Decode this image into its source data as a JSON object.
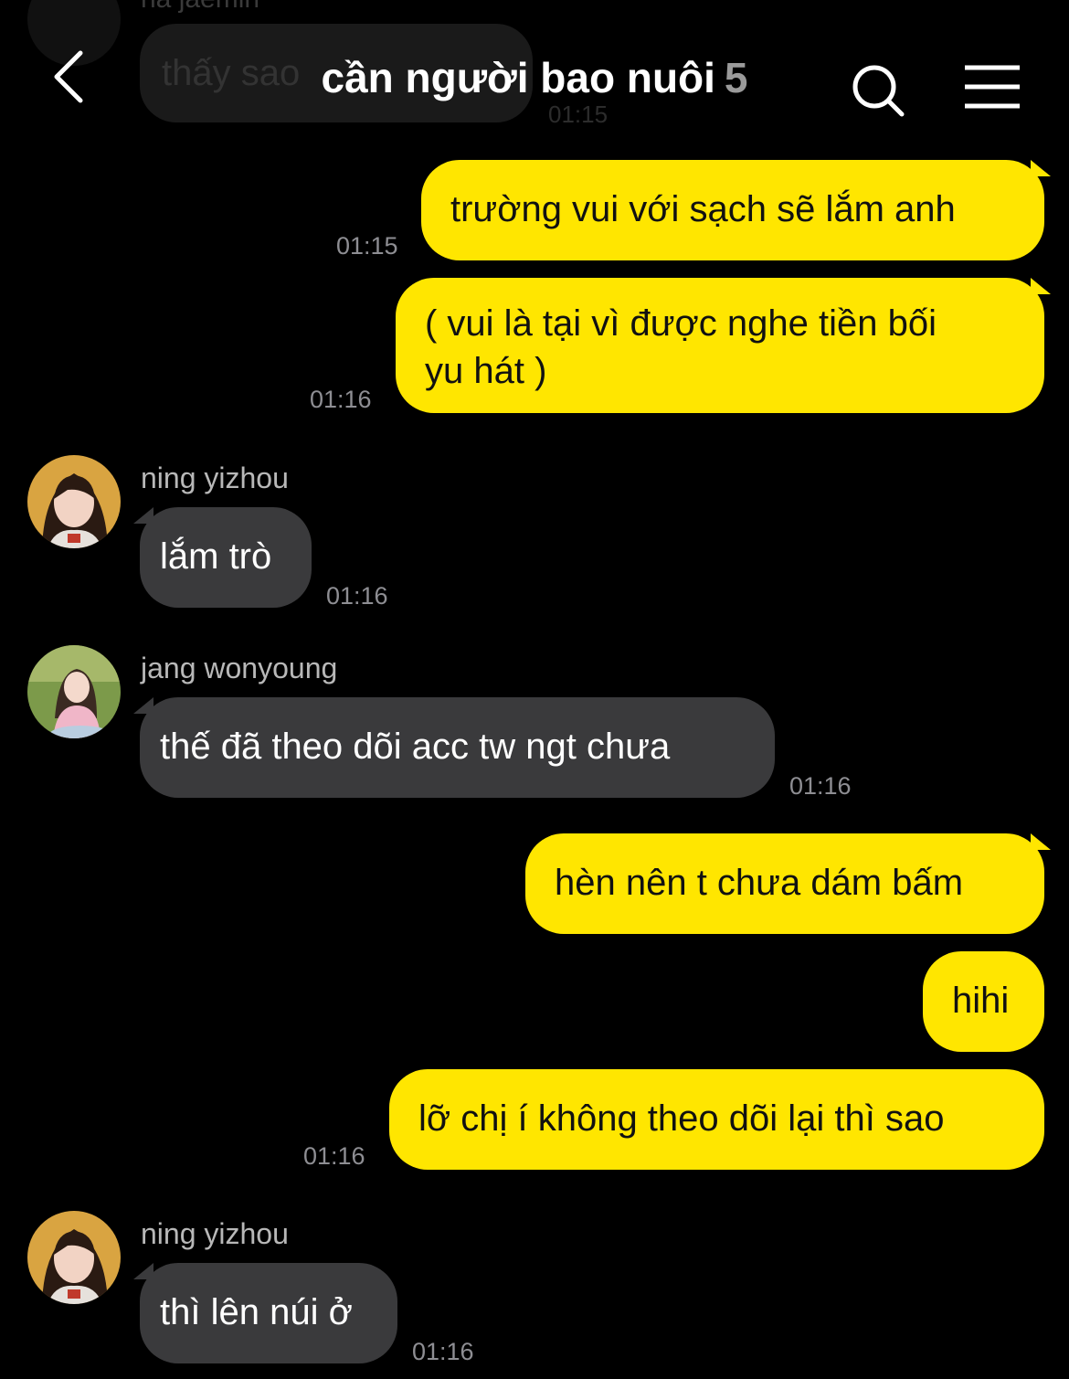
{
  "faded": {
    "sender": "na jaemin",
    "text": "thấy sao",
    "time": "01:15"
  },
  "header": {
    "title": "cần người bao nuôi",
    "member_count": "5",
    "icons": {
      "back": "chevron-left-icon",
      "search": "search-icon",
      "menu": "hamburger-menu-icon"
    }
  },
  "messages": [
    {
      "from": "me",
      "text": "trường vui với sạch sẽ lắm anh",
      "time": "01:15"
    },
    {
      "from": "me",
      "text": "( vui là tại vì được nghe tiền bối yu hát )",
      "line1": "( vui là tại vì được nghe tiền bối",
      "line2": "yu hát )",
      "time": "01:16"
    },
    {
      "from": "ning yizhou",
      "text": "lắm trò",
      "time": "01:16"
    },
    {
      "from": "jang wonyoung",
      "text": "thế đã theo dõi acc tw ngt chưa",
      "time": "01:16"
    },
    {
      "from": "me",
      "text": "hèn nên t chưa dám bấm"
    },
    {
      "from": "me",
      "text": "hihi"
    },
    {
      "from": "me",
      "text": "lỡ chị í không theo dõi lại thì sao",
      "time": "01:16"
    },
    {
      "from": "ning yizhou",
      "text": "thì lên núi ở",
      "time": "01:16"
    }
  ],
  "colors": {
    "my_bubble": "#ffe600",
    "their_bubble": "#3a3a3c",
    "background": "#000000"
  }
}
